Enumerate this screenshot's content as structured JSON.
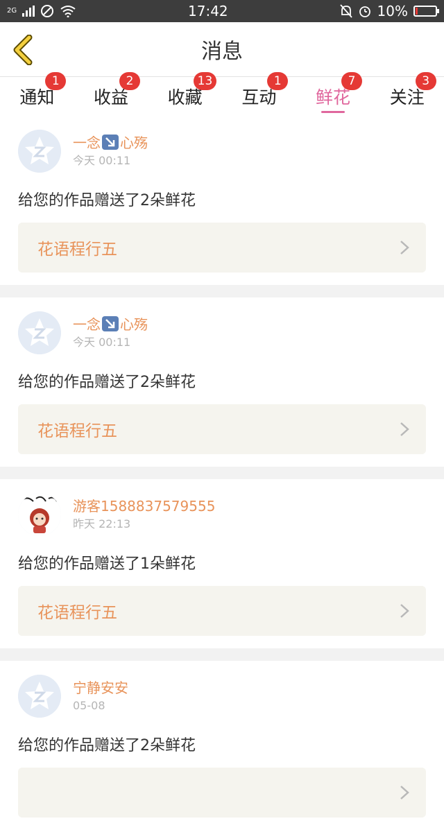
{
  "status_bar": {
    "network": "2G",
    "time": "17:42",
    "battery": "10%",
    "battery_level": 0.1,
    "icons": [
      "signal-icon",
      "blocked-icon",
      "wifi-icon",
      "mute-icon",
      "alarm-icon",
      "battery-icon"
    ]
  },
  "header": {
    "title": "消息",
    "back_icon": "chevron-left-icon"
  },
  "tabs": [
    {
      "label": "通知",
      "badge": "1",
      "active": false
    },
    {
      "label": "收益",
      "badge": "2",
      "active": false
    },
    {
      "label": "收藏",
      "badge": "13",
      "active": false
    },
    {
      "label": "互动",
      "badge": "1",
      "active": false
    },
    {
      "label": "鲜花",
      "badge": "7",
      "active": true
    },
    {
      "label": "关注",
      "badge": "3",
      "active": false
    }
  ],
  "messages": [
    {
      "user_prefix": "一念",
      "user_suffix": "心殇",
      "has_emoji": true,
      "time": "今天 00:11",
      "text": "给您的作品赠送了2朵鲜花",
      "work": "花语程行五",
      "avatar": "default-avatar-icon"
    },
    {
      "user_prefix": "一念",
      "user_suffix": "心殇",
      "has_emoji": true,
      "time": "今天 00:11",
      "text": "给您的作品赠送了2朵鲜花",
      "work": "花语程行五",
      "avatar": "default-avatar-icon"
    },
    {
      "user_prefix": "游客1588837579555",
      "user_suffix": "",
      "has_emoji": false,
      "time": "昨天 22:13",
      "text": "给您的作品赠送了1朵鲜花",
      "work": "花语程行五",
      "avatar": "custom-avatar-image"
    },
    {
      "user_prefix": "宁静安安",
      "user_suffix": "",
      "has_emoji": false,
      "time": "05-08",
      "text": "给您的作品赠送了2朵鲜花",
      "work": "",
      "avatar": "default-avatar-icon"
    }
  ],
  "colors": {
    "accent_pink": "#e0679d",
    "username_orange": "#e8935a",
    "badge_red": "#e53935",
    "back_yellow": "#f4d03f"
  }
}
